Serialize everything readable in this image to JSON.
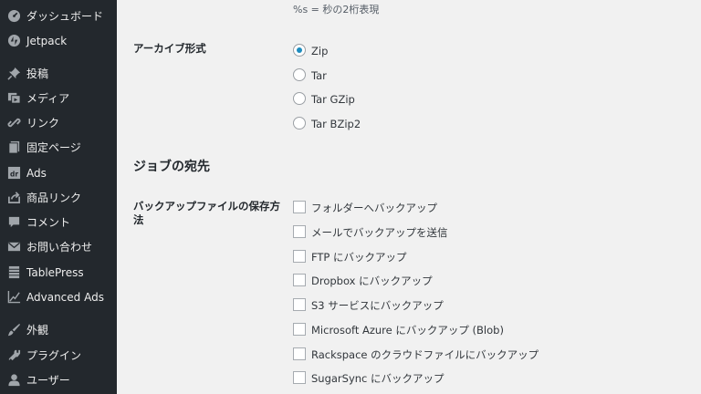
{
  "sidebar": {
    "items": [
      {
        "label": "ダッシュボード",
        "icon": "dashboard-icon"
      },
      {
        "label": "Jetpack",
        "icon": "jetpack-icon"
      },
      {
        "label": "投稿",
        "icon": "pin-icon"
      },
      {
        "label": "メディア",
        "icon": "media-icon"
      },
      {
        "label": "リンク",
        "icon": "link-icon"
      },
      {
        "label": "固定ページ",
        "icon": "page-icon"
      },
      {
        "label": "Ads",
        "icon": "ads-icon"
      },
      {
        "label": "商品リンク",
        "icon": "share-icon"
      },
      {
        "label": "コメント",
        "icon": "comment-icon"
      },
      {
        "label": "お問い合わせ",
        "icon": "mail-icon"
      },
      {
        "label": "TablePress",
        "icon": "table-icon"
      },
      {
        "label": "Advanced Ads",
        "icon": "chart-icon"
      },
      {
        "label": "外観",
        "icon": "brush-icon"
      },
      {
        "label": "プラグイン",
        "icon": "plugin-icon"
      },
      {
        "label": "ユーザー",
        "icon": "user-icon"
      }
    ]
  },
  "settings": {
    "seconds_hint": "%s = 秒の2桁表現",
    "archive_format": {
      "label": "アーカイブ形式",
      "selected": "Zip",
      "options": [
        "Zip",
        "Tar",
        "Tar GZip",
        "Tar BZip2"
      ]
    },
    "job_destination_heading": "ジョブの宛先",
    "backup_destination": {
      "label_line1": "バックアップファイルの保存方",
      "label_line2": "法",
      "options": [
        "フォルダーへバックアップ",
        "メールでバックアップを送信",
        "FTP にバックアップ",
        "Dropbox にバックアップ",
        "S3 サービスにバックアップ",
        "Microsoft Azure にバックアップ (Blob)",
        "Rackspace のクラウドファイルにバックアップ",
        "SugarSync にバックアップ"
      ]
    }
  },
  "colors": {
    "sidebar_bg": "#23282d",
    "content_bg": "#f1f1f1",
    "radio_selected": "#1e8cbe"
  }
}
